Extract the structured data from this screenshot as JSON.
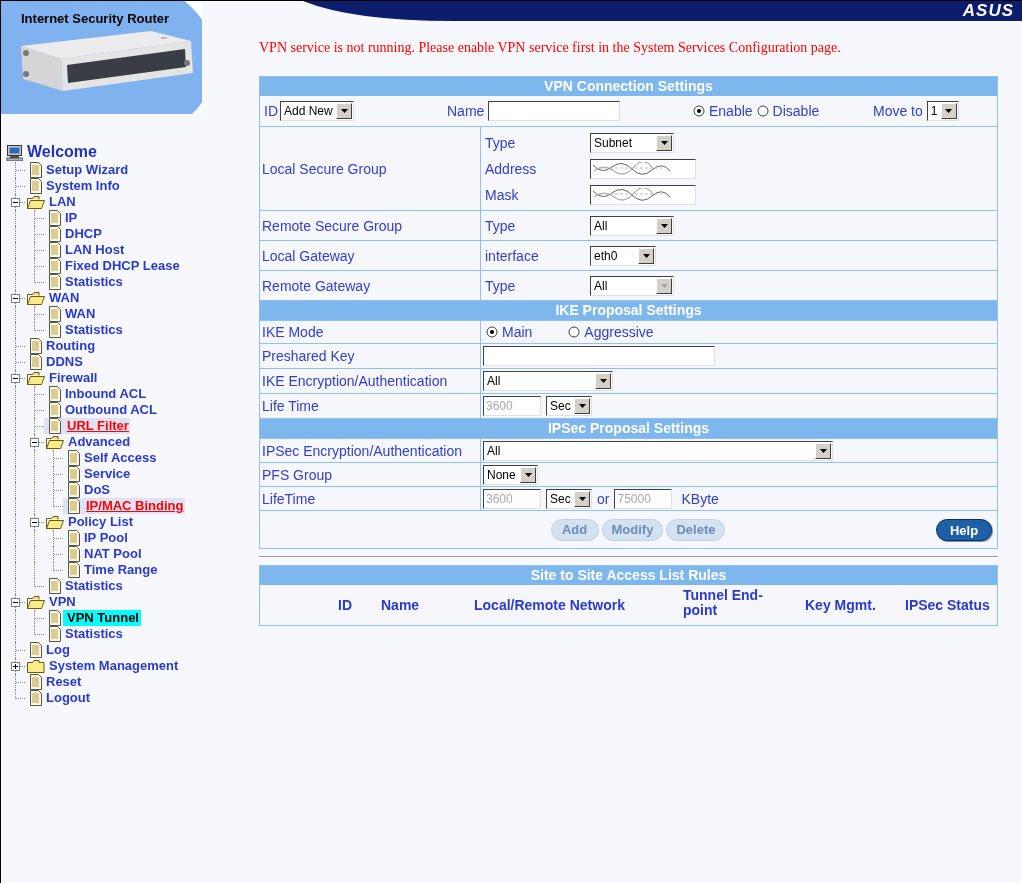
{
  "banner": {
    "title": "Internet Security Router",
    "logo": "ASUS"
  },
  "nav": {
    "items": [
      {
        "label": "Welcome",
        "kind": "root",
        "children": [
          {
            "label": "Setup Wizard",
            "kind": "page",
            "selected": false,
            "visited": false
          },
          {
            "label": "System Info",
            "kind": "page",
            "selected": false,
            "visited": false
          },
          {
            "label": "LAN",
            "kind": "folder",
            "expanded": true,
            "children": [
              {
                "label": "IP",
                "kind": "page",
                "selected": false,
                "visited": false
              },
              {
                "label": "DHCP",
                "kind": "page",
                "selected": false,
                "visited": false
              },
              {
                "label": "LAN Host",
                "kind": "page",
                "selected": false,
                "visited": false
              },
              {
                "label": "Fixed DHCP Lease",
                "kind": "page",
                "selected": false,
                "visited": false
              },
              {
                "label": "Statistics",
                "kind": "page",
                "selected": false,
                "visited": false
              }
            ]
          },
          {
            "label": "WAN",
            "kind": "folder",
            "expanded": true,
            "children": [
              {
                "label": "WAN",
                "kind": "page",
                "selected": false,
                "visited": false
              },
              {
                "label": "Statistics",
                "kind": "page",
                "selected": false,
                "visited": false
              }
            ]
          },
          {
            "label": "Routing",
            "kind": "page",
            "selected": false,
            "visited": false
          },
          {
            "label": "DDNS",
            "kind": "page",
            "selected": false,
            "visited": false
          },
          {
            "label": "Firewall",
            "kind": "folder",
            "expanded": true,
            "children": [
              {
                "label": "Inbound ACL",
                "kind": "page",
                "selected": false,
                "visited": false
              },
              {
                "label": "Outbound ACL",
                "kind": "page",
                "selected": false,
                "visited": false
              },
              {
                "label": "URL Filter",
                "kind": "page",
                "selected": false,
                "visited": true
              },
              {
                "label": "Advanced",
                "kind": "folder",
                "expanded": true,
                "children": [
                  {
                    "label": "Self Access",
                    "kind": "page",
                    "selected": false,
                    "visited": false
                  },
                  {
                    "label": "Service",
                    "kind": "page",
                    "selected": false,
                    "visited": false
                  },
                  {
                    "label": "DoS",
                    "kind": "page",
                    "selected": false,
                    "visited": false
                  },
                  {
                    "label": "IP/MAC Binding",
                    "kind": "page",
                    "selected": false,
                    "visited": true
                  }
                ]
              },
              {
                "label": "Policy List",
                "kind": "folder",
                "expanded": true,
                "children": [
                  {
                    "label": "IP Pool",
                    "kind": "page",
                    "selected": false,
                    "visited": false
                  },
                  {
                    "label": "NAT Pool",
                    "kind": "page",
                    "selected": false,
                    "visited": false
                  },
                  {
                    "label": "Time Range",
                    "kind": "page",
                    "selected": false,
                    "visited": false
                  }
                ]
              },
              {
                "label": "Statistics",
                "kind": "page",
                "selected": false,
                "visited": false
              }
            ]
          },
          {
            "label": "VPN",
            "kind": "folder",
            "expanded": true,
            "children": [
              {
                "label": "VPN Tunnel",
                "kind": "page",
                "selected": true,
                "visited": false
              },
              {
                "label": "Statistics",
                "kind": "page",
                "selected": false,
                "visited": false
              }
            ]
          },
          {
            "label": "Log",
            "kind": "page",
            "selected": false,
            "visited": false
          },
          {
            "label": "System Management",
            "kind": "folder",
            "expanded": false
          },
          {
            "label": "Reset",
            "kind": "page",
            "selected": false,
            "visited": false
          },
          {
            "label": "Logout",
            "kind": "page",
            "selected": false,
            "visited": false
          }
        ]
      }
    ]
  },
  "notice": "VPN service is not running. Please enable VPN service first in the System Services Configuration page.",
  "vpn_connection": {
    "title": "VPN Connection Settings",
    "id": {
      "label": "ID",
      "value": "Add New"
    },
    "name": {
      "label": "Name"
    },
    "status_options": [
      {
        "label": "Enable",
        "selected": true
      },
      {
        "label": "Disable",
        "selected": false
      }
    ],
    "move_to": {
      "label": "Move to",
      "value": "1"
    },
    "rows": [
      {
        "label": "Local Secure Group",
        "fields": [
          {
            "label": "Type",
            "kind": "select",
            "value": "Subnet",
            "disabled": false
          },
          {
            "label": "Address",
            "kind": "scribbled",
            "disabled": false
          },
          {
            "label": "Mask",
            "kind": "scribbled",
            "disabled": false
          }
        ]
      },
      {
        "label": "Remote Secure Group",
        "fields": [
          {
            "label": "Type",
            "kind": "select",
            "value": "All",
            "disabled": false
          }
        ]
      },
      {
        "label": "Local Gateway",
        "fields": [
          {
            "label": "interface",
            "kind": "select",
            "value": "eth0",
            "disabled": false
          }
        ]
      },
      {
        "label": "Remote Gateway",
        "fields": [
          {
            "label": "Type",
            "kind": "select",
            "value": "All",
            "disabled": true
          }
        ]
      }
    ]
  },
  "ike_proposal": {
    "title": "IKE Proposal Settings",
    "rows": [
      {
        "label": "IKE Mode",
        "kind": "radio",
        "options": [
          {
            "label": "Main",
            "selected": true
          },
          {
            "label": "Aggressive",
            "selected": false
          }
        ]
      },
      {
        "label": "Preshared Key",
        "kind": "input"
      },
      {
        "label": "IKE Encryption/Authentication",
        "kind": "select",
        "value": "All"
      },
      {
        "label": "Life Time",
        "kind": "lifetime",
        "placeholder": "3600",
        "unit": "Sec"
      }
    ]
  },
  "ipsec_proposal": {
    "title": "IPSec Proposal Settings",
    "rows": [
      {
        "label": "IPSec Encryption/Authentication",
        "kind": "select",
        "value": "All"
      },
      {
        "label": "PFS Group",
        "kind": "select",
        "value": "None"
      },
      {
        "label": "LifeTime",
        "kind": "lifetime",
        "placeholder": "3600",
        "unit": "Sec",
        "joiner": "or",
        "placeholder2": "75000",
        "unit2": "KByte"
      }
    ]
  },
  "buttons": [
    {
      "label": "Add",
      "kind": "action",
      "disabled": true
    },
    {
      "label": "Modify",
      "kind": "action",
      "disabled": true
    },
    {
      "label": "Delete",
      "kind": "action",
      "disabled": true
    },
    {
      "label": "Help",
      "kind": "help",
      "disabled": false
    }
  ],
  "access_list": {
    "title": "Site to Site Access List Rules",
    "columns": [
      "ID",
      "Name",
      "Local/Remote Network",
      "Tunnel End-point",
      "Key Mgmt.",
      "IPSec Status"
    ]
  }
}
